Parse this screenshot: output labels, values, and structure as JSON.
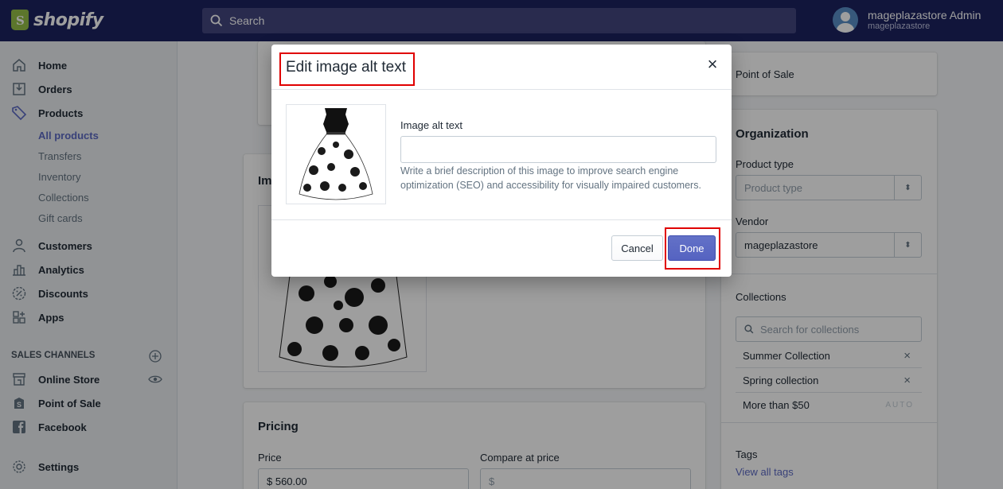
{
  "header": {
    "logo_text": "shopify",
    "search_placeholder": "Search",
    "user_name": "mageplazastore Admin",
    "user_store": "mageplazastore"
  },
  "sidebar": {
    "items": [
      {
        "label": "Home",
        "icon": "home-icon"
      },
      {
        "label": "Orders",
        "icon": "orders-icon"
      },
      {
        "label": "Products",
        "icon": "tag-icon"
      }
    ],
    "product_subitems": [
      "All products",
      "Transfers",
      "Inventory",
      "Collections",
      "Gift cards"
    ],
    "items2": [
      {
        "label": "Customers",
        "icon": "person-icon"
      },
      {
        "label": "Analytics",
        "icon": "bar-chart-icon"
      },
      {
        "label": "Discounts",
        "icon": "discount-icon"
      },
      {
        "label": "Apps",
        "icon": "apps-icon"
      }
    ],
    "section_title": "SALES CHANNELS",
    "channels": [
      {
        "label": "Online Store",
        "icon": "store-icon"
      },
      {
        "label": "Point of Sale",
        "icon": "pos-icon"
      },
      {
        "label": "Facebook",
        "icon": "facebook-icon"
      }
    ],
    "settings_label": "Settings"
  },
  "background": {
    "images_title": "Im",
    "pricing_title": "Pricing",
    "price_label": "Price",
    "price_value": "$ 560.00",
    "compare_label": "Compare at price",
    "compare_placeholder": "$",
    "point_of_sale": "Point of Sale",
    "organization_title": "Organization",
    "product_type_label": "Product type",
    "product_type_placeholder": "Product type",
    "vendor_label": "Vendor",
    "vendor_value": "mageplazastore",
    "collections_label": "Collections",
    "collections_search": "Search for collections",
    "collections": [
      "Summer Collection",
      "Spring collection",
      "More than $50"
    ],
    "auto_badge": "AUTO",
    "tags_label": "Tags",
    "tags_link": "View all tags"
  },
  "modal": {
    "title": "Edit image alt text",
    "close_glyph": "×",
    "alt_label": "Image alt text",
    "alt_value": "",
    "help_text": "Write a brief description of this image to improve search engine optimization (SEO) and accessibility for visually impaired customers.",
    "cancel_label": "Cancel",
    "done_label": "Done"
  },
  "colors": {
    "topbar": "#1c2260",
    "accent": "#5c6ac4",
    "highlight": "#e00000"
  }
}
